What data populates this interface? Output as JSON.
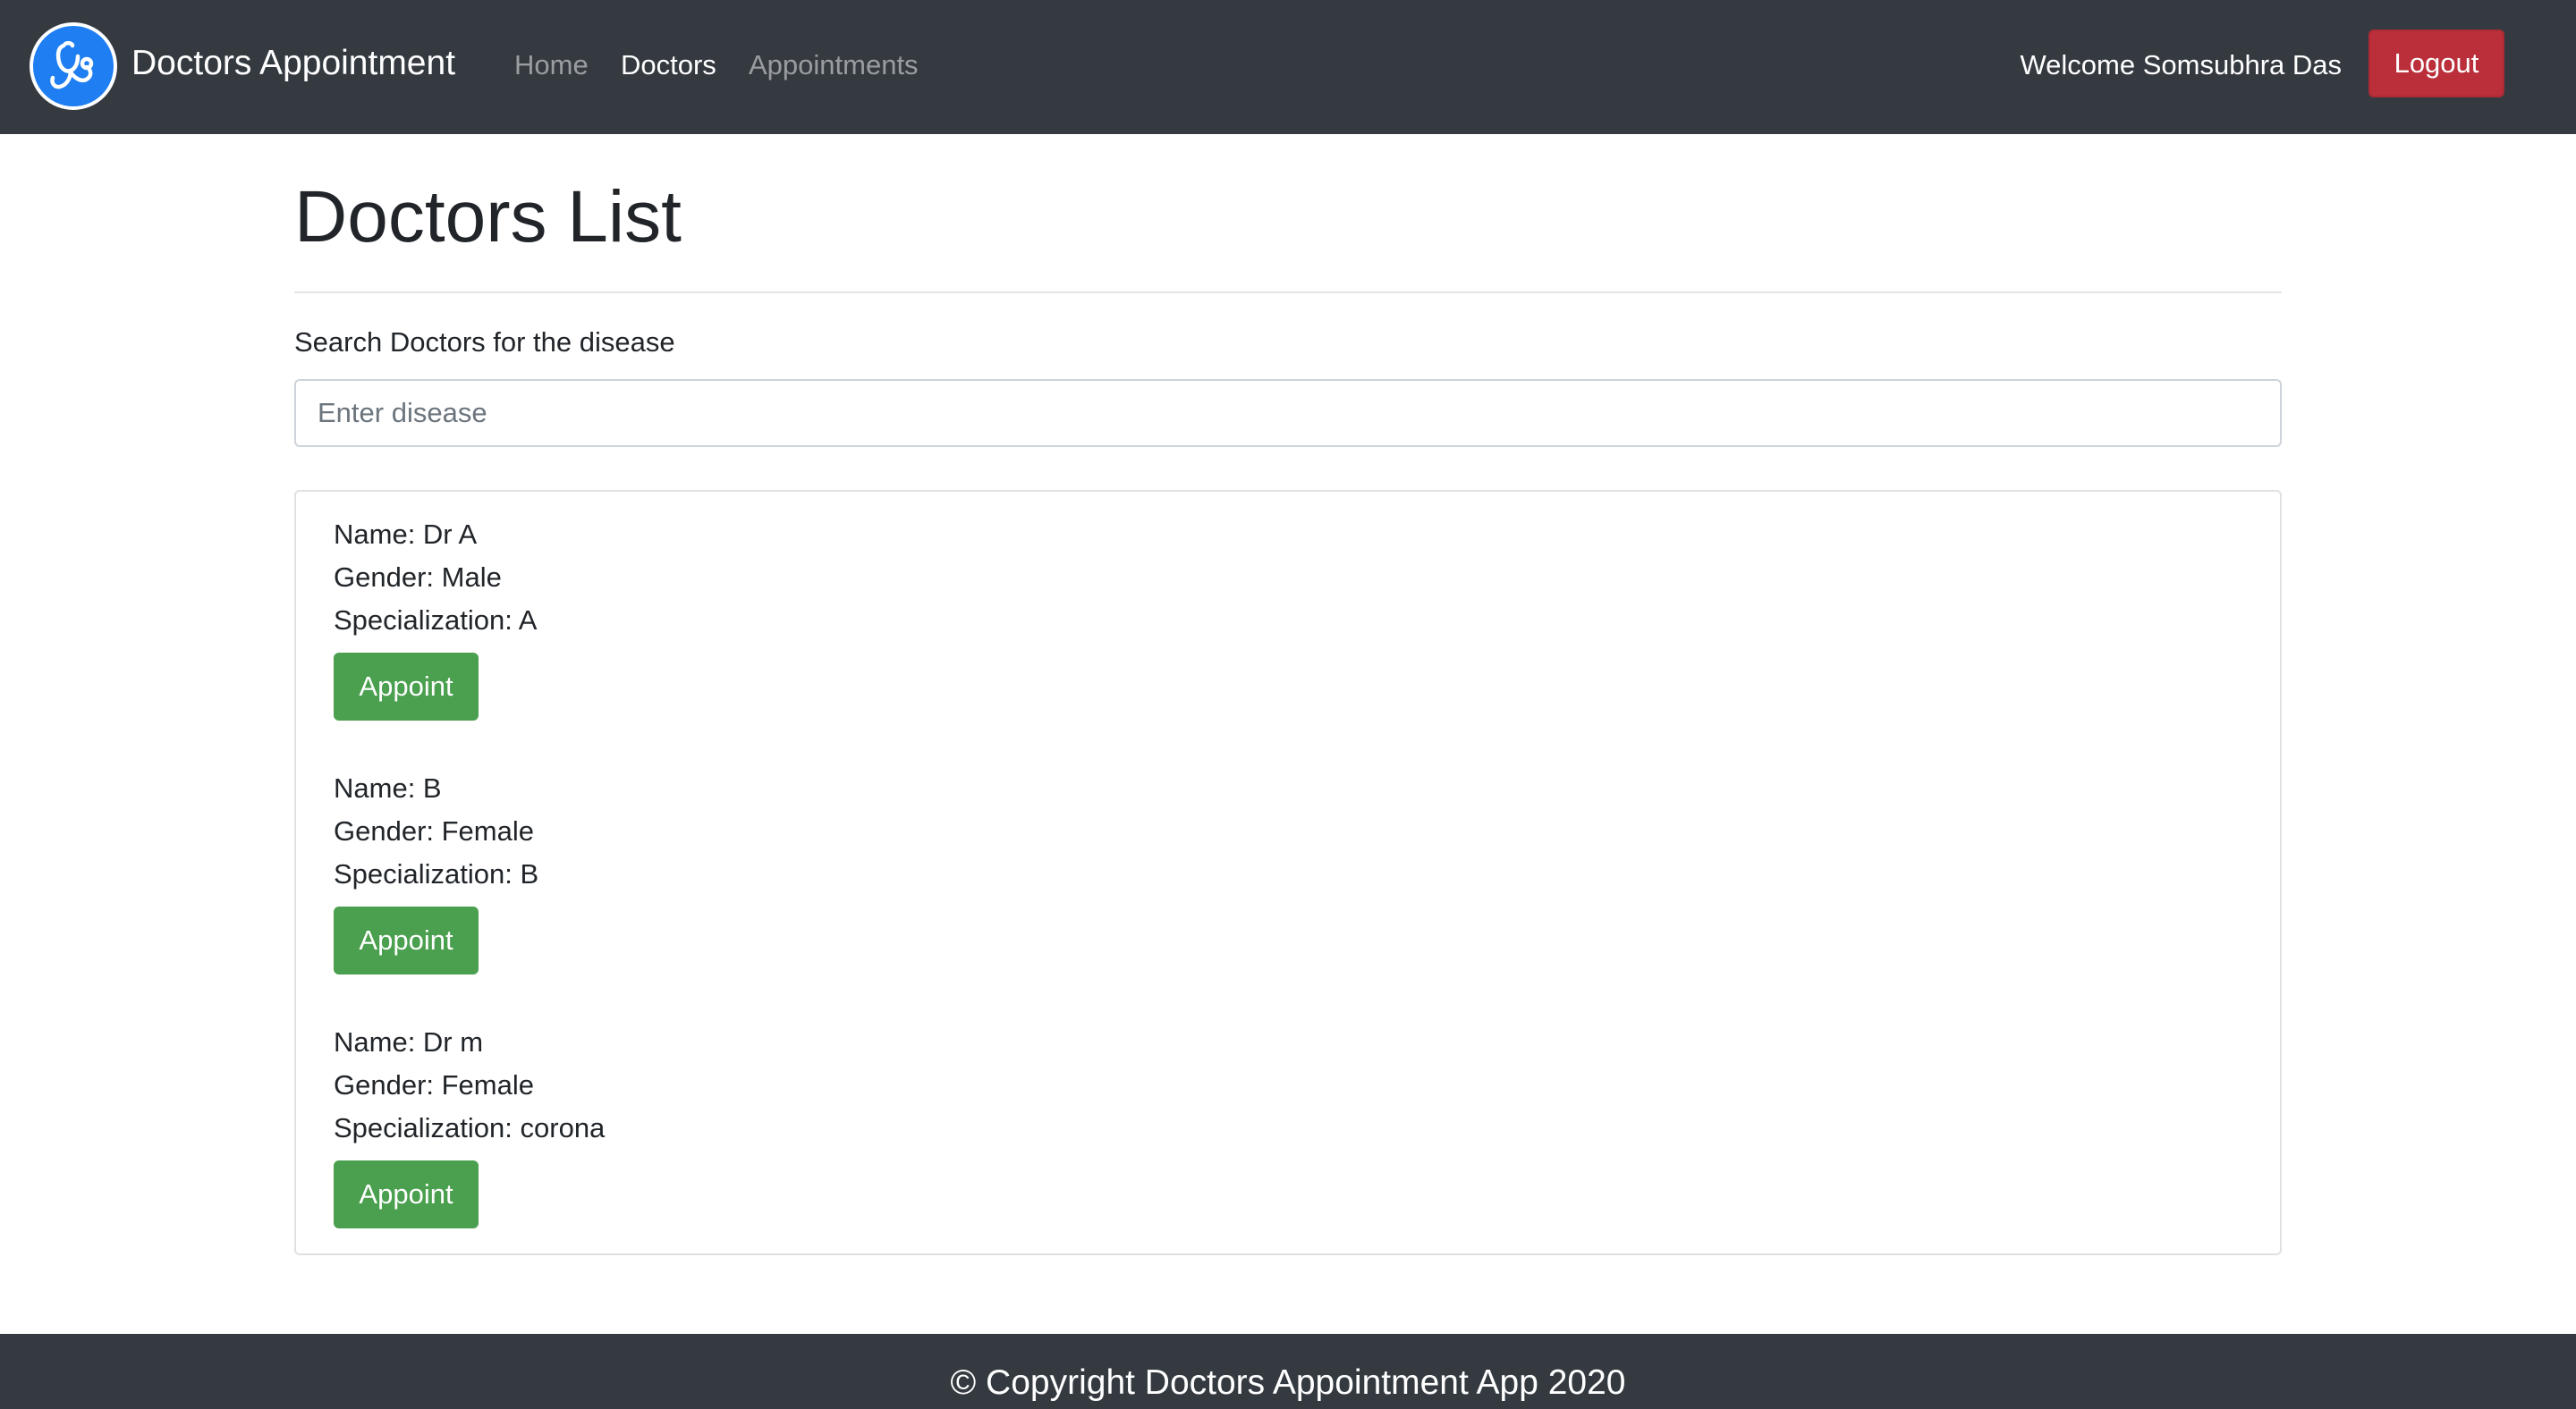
{
  "navbar": {
    "brand_icon": "stethoscope-icon",
    "brand_name": "Doctors Appointment",
    "links": [
      {
        "label": "Home",
        "active": false
      },
      {
        "label": "Doctors",
        "active": true
      },
      {
        "label": "Appointments",
        "active": false
      }
    ],
    "welcome_text": "Welcome Somsubhra Das",
    "logout_label": "Logout"
  },
  "main": {
    "title": "Doctors List",
    "search_label": "Search Doctors for the disease",
    "search_placeholder": "Enter disease",
    "search_value": "",
    "doctors": [
      {
        "name": "Name: Dr A",
        "gender": "Gender: Male",
        "specialization": "Specialization: A",
        "button": "Appoint"
      },
      {
        "name": "Name: B",
        "gender": "Gender: Female",
        "specialization": "Specialization: B",
        "button": "Appoint"
      },
      {
        "name": "Name: Dr m",
        "gender": "Gender: Female",
        "specialization": "Specialization: corona",
        "button": "Appoint"
      }
    ]
  },
  "footer": {
    "text": "© Copyright Doctors Appointment App 2020"
  },
  "colors": {
    "navbar_bg": "#343a40",
    "logout_bg": "#ba2f3a",
    "appoint_bg": "#4aa04f",
    "brand_icon_bg": "#1e7ef2"
  }
}
